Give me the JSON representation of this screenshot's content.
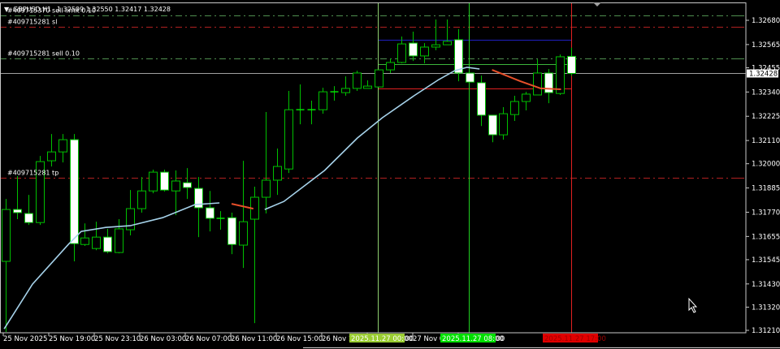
{
  "header": {
    "menu_icon": "triangle-down-icon",
    "symbol": "GBPUSD,H1",
    "ohlc": "1.32509 1.32550 1.32417 1.32428"
  },
  "colors": {
    "background": "#000000",
    "bull_border": "#00c000",
    "bear_body": "#ffffff",
    "ma_up": "#a6d2ea",
    "ma_down": "#e8502a",
    "order_green": "#5a8f5a",
    "order_red": "#b02020",
    "bid_line": "#a0a0a0",
    "time_highlight_1": "#9acd32",
    "time_highlight_2": "#00e000",
    "time_highlight_3": "#e00000"
  },
  "order_lines": [
    {
      "label": "#409715370 sell limit 0.10",
      "price": 1.32703,
      "color": "#4f8f4f"
    },
    {
      "label": "#409715281 sl",
      "price": 1.32649,
      "color": "#b02020"
    },
    {
      "label": "#409715281 sell 0.10",
      "price": 1.32499,
      "color": "#4f8f4f"
    },
    {
      "label": "#409715281 tp",
      "price": 1.31933,
      "color": "#b02020"
    }
  ],
  "bid_price_label": "1.32428",
  "bid_price": 1.32428,
  "range_lines": [
    {
      "price": 1.32588,
      "color": "#2020c0"
    },
    {
      "price": 1.32472,
      "color": "#3cb43c"
    },
    {
      "price": 1.32357,
      "color": "#e02020"
    }
  ],
  "time_markers": [
    {
      "label": "2025.11.27 00:00",
      "index": 32.9,
      "color": "#9acd32",
      "line": "#8fcf6f"
    },
    {
      "label": "2025.11.27 08:00",
      "index": 40.95,
      "color": "#00e000",
      "line": "#20d020"
    },
    {
      "label": "2025.11.27 17:00",
      "index": 50,
      "color": "#e00000",
      "line": "#e02020"
    }
  ],
  "price_axis": [
    "1.32680",
    "1.32565",
    "1.32455",
    "1.32340",
    "1.32225",
    "1.32110",
    "1.32000",
    "1.31885",
    "1.31770",
    "1.31655",
    "1.31545",
    "1.31430",
    "1.31320",
    "1.31210"
  ],
  "time_axis": [
    "25 Nov 2025",
    "25 Nov 19:00",
    "25 Nov 23:10",
    "26 Nov 03:00",
    "26 Nov 07:00",
    "26 Nov 11:00",
    "26 Nov 15:00",
    "26 Nov 19:00",
    "27 Nov 03:00",
    "27 Nov 07:00",
    "27 Nov 11:00"
  ],
  "chart_data": {
    "type": "candlestick",
    "symbol": "GBPUSD",
    "timeframe": "H1",
    "ylim": [
      1.31195,
      1.3272
    ],
    "candles": [
      [
        1.31537,
        1.31833,
        1.31198,
        1.31783
      ],
      [
        1.31783,
        1.31941,
        1.31737,
        1.31768
      ],
      [
        1.31764,
        1.31852,
        1.3171,
        1.31721
      ],
      [
        1.31721,
        1.32037,
        1.3171,
        1.3201
      ],
      [
        1.32014,
        1.32141,
        1.31987,
        1.32056
      ],
      [
        1.32056,
        1.32141,
        1.32006,
        1.32114
      ],
      [
        1.32114,
        1.32141,
        1.31537,
        1.31621
      ],
      [
        1.31617,
        1.31717,
        1.3161,
        1.31648
      ],
      [
        1.31598,
        1.31725,
        1.3159,
        1.31652
      ],
      [
        1.31652,
        1.31691,
        1.31575,
        1.31583
      ],
      [
        1.31579,
        1.31737,
        1.31575,
        1.31691
      ],
      [
        1.31687,
        1.31875,
        1.3166,
        1.31787
      ],
      [
        1.31787,
        1.31937,
        1.31768,
        1.31871
      ],
      [
        1.31871,
        1.31972,
        1.3186,
        1.3196
      ],
      [
        1.3196,
        1.31972,
        1.31868,
        1.31875
      ],
      [
        1.31871,
        1.31968,
        1.31756,
        1.31918
      ],
      [
        1.3191,
        1.31979,
        1.31833,
        1.31887
      ],
      [
        1.31883,
        1.31937,
        1.31652,
        1.31791
      ],
      [
        1.31791,
        1.31871,
        1.31679,
        1.31741
      ],
      [
        1.31741,
        1.31775,
        1.31687,
        1.31739
      ],
      [
        1.31744,
        1.31768,
        1.31571,
        1.31617
      ],
      [
        1.31614,
        1.32014,
        1.31506,
        1.31725
      ],
      [
        1.31737,
        1.31891,
        1.31244,
        1.31841
      ],
      [
        1.31841,
        1.32245,
        1.31764,
        1.31922
      ],
      [
        1.31922,
        1.32072,
        1.31852,
        1.31987
      ],
      [
        1.31975,
        1.32345,
        1.31956,
        1.32256
      ],
      [
        1.32256,
        1.32376,
        1.32187,
        1.32254
      ],
      [
        1.32256,
        1.32299,
        1.32187,
        1.32254
      ],
      [
        1.32256,
        1.3236,
        1.32237,
        1.32341
      ],
      [
        1.32341,
        1.32368,
        1.32299,
        1.32339
      ],
      [
        1.32337,
        1.32414,
        1.32322,
        1.32357
      ],
      [
        1.32357,
        1.32441,
        1.32345,
        1.3243
      ],
      [
        1.32357,
        1.32395,
        1.32357,
        1.32368
      ],
      [
        1.32364,
        1.32445,
        1.32364,
        1.32445
      ],
      [
        1.32445,
        1.32499,
        1.3243,
        1.3248
      ],
      [
        1.3248,
        1.32603,
        1.32476,
        1.32568
      ],
      [
        1.32572,
        1.32626,
        1.32487,
        1.32511
      ],
      [
        1.32511,
        1.32572,
        1.32476,
        1.32553
      ],
      [
        1.32553,
        1.32684,
        1.32538,
        1.32564
      ],
      [
        1.32564,
        1.32684,
        1.32564,
        1.3258
      ],
      [
        1.32588,
        1.32638,
        1.32391,
        1.3243
      ],
      [
        1.3243,
        1.3243,
        1.32387,
        1.32387
      ],
      [
        1.32384,
        1.32418,
        1.32179,
        1.3223
      ],
      [
        1.3223,
        1.3223,
        1.32102,
        1.32137
      ],
      [
        1.32137,
        1.32268,
        1.32114,
        1.32237
      ],
      [
        1.32233,
        1.32322,
        1.32203,
        1.32295
      ],
      [
        1.32295,
        1.32341,
        1.32253,
        1.3233
      ],
      [
        1.32326,
        1.32495,
        1.32326,
        1.3243
      ],
      [
        1.3243,
        1.32449,
        1.32287,
        1.32337
      ],
      [
        1.32333,
        1.32518,
        1.32326,
        1.32507
      ],
      [
        1.32509,
        1.3255,
        1.32417,
        1.32428
      ]
    ],
    "ma_segments": [
      {
        "trend": "up",
        "points": [
          [
            -0.14,
            1.31217
          ],
          [
            2.37,
            1.31429
          ],
          [
            5.6,
            1.31621
          ],
          [
            6.68,
            1.31679
          ],
          [
            8.84,
            1.31698
          ],
          [
            11,
            1.31706
          ],
          [
            13.87,
            1.31744
          ],
          [
            16.74,
            1.31806
          ],
          [
            18.9,
            1.31814
          ]
        ]
      },
      {
        "trend": "down",
        "points": [
          [
            19.97,
            1.3181
          ],
          [
            21.9,
            1.31787
          ]
        ]
      },
      {
        "trend": "up",
        "points": [
          [
            22.9,
            1.31783
          ],
          [
            24.6,
            1.31821
          ],
          [
            28.2,
            1.31968
          ],
          [
            31.1,
            1.32122
          ],
          [
            33.3,
            1.32218
          ],
          [
            36.1,
            1.32322
          ],
          [
            38.3,
            1.32399
          ],
          [
            39.7,
            1.32441
          ],
          [
            40.8,
            1.32457
          ],
          [
            41.9,
            1.32449
          ]
        ]
      },
      {
        "trend": "down",
        "points": [
          [
            43,
            1.32445
          ],
          [
            45.5,
            1.32391
          ],
          [
            47.3,
            1.32357
          ],
          [
            49.1,
            1.32353
          ]
        ]
      }
    ]
  }
}
